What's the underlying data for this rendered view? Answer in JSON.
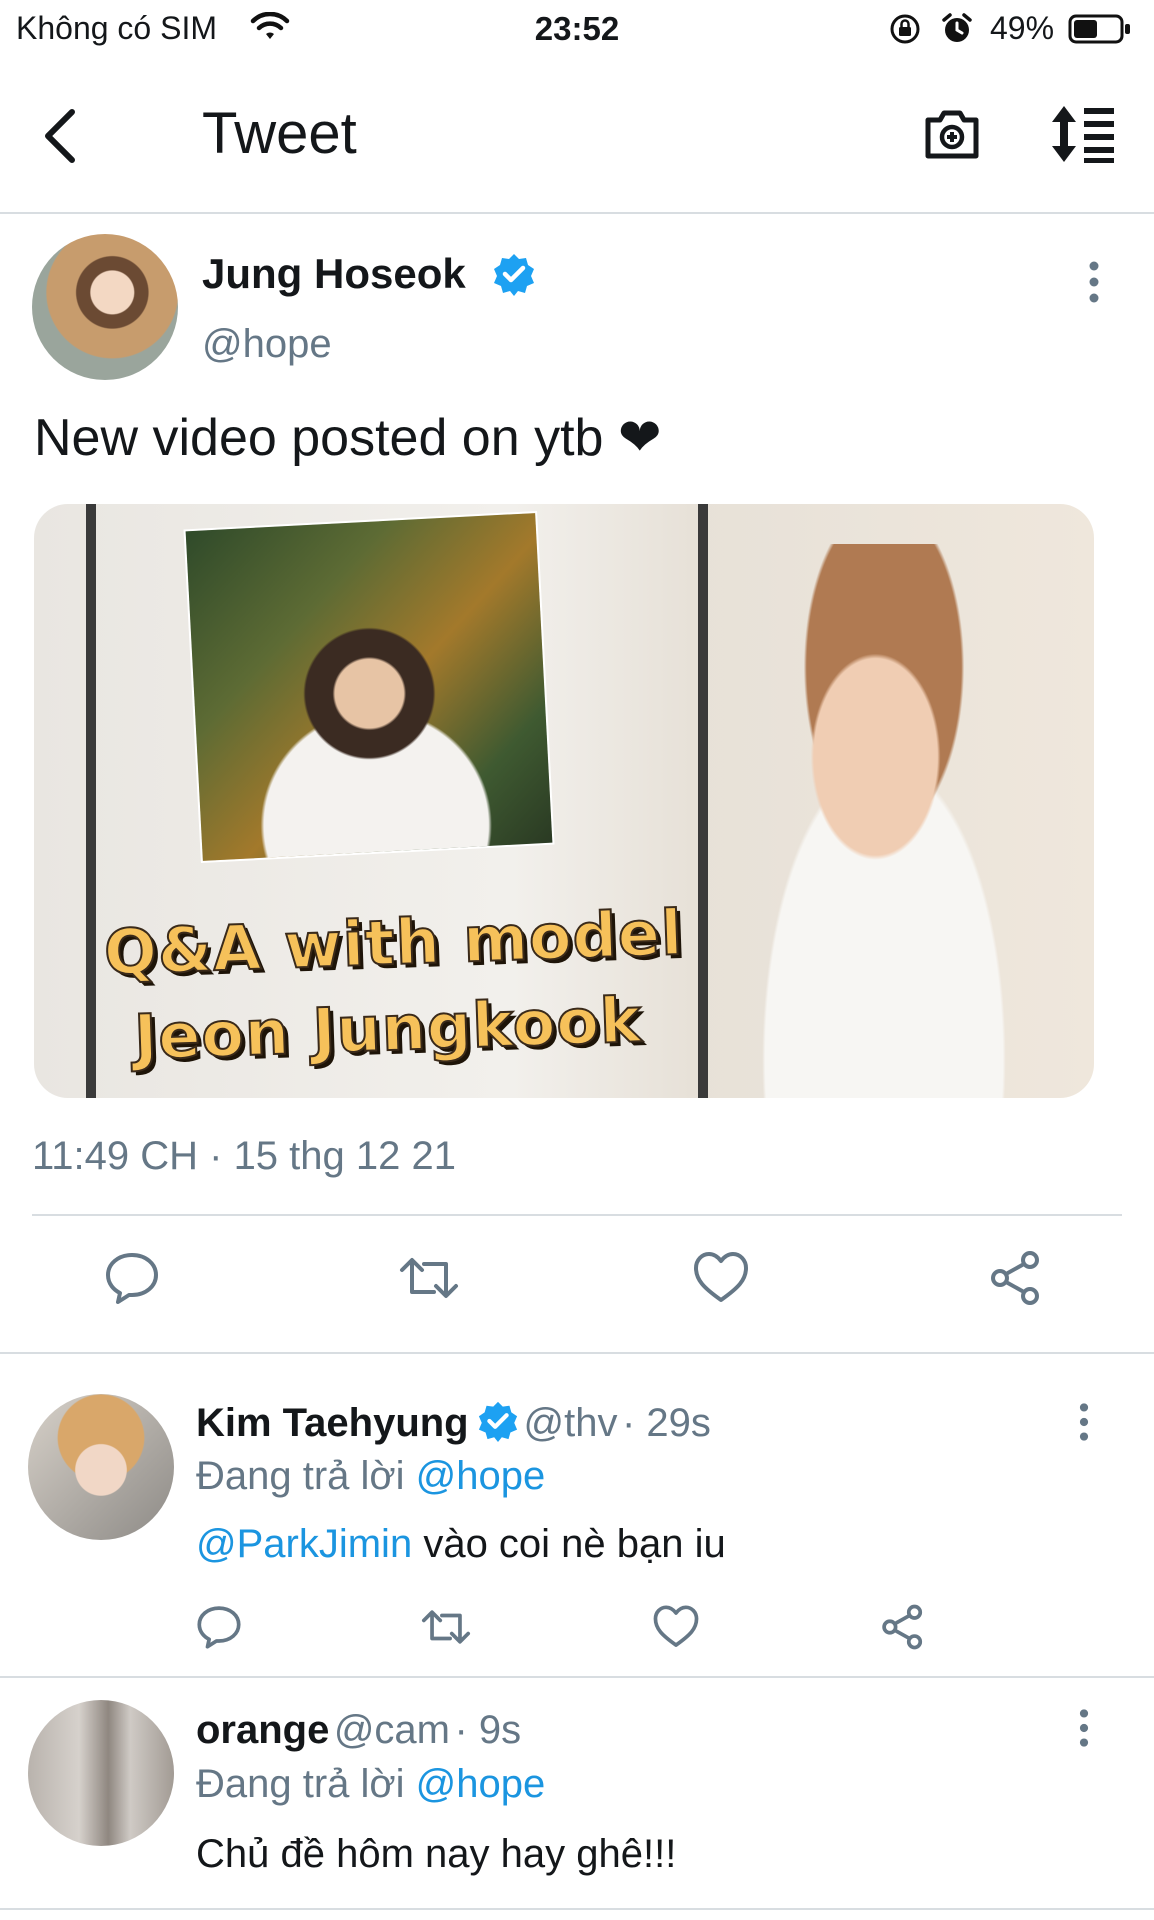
{
  "status_bar": {
    "carrier": "Không có SIM",
    "time": "23:52",
    "battery": "49%"
  },
  "nav": {
    "title": "Tweet"
  },
  "tweet": {
    "author_name": "Jung Hoseok",
    "author_handle": "@hope",
    "text": "New video posted on ytb ❤",
    "media_caption_line1": "Q&A with model",
    "media_caption_line2": "Jeon Jungkook",
    "timestamp": "11:49 CH · 15 thg 12 21"
  },
  "replies": [
    {
      "name": "Kim Taehyung",
      "handle": "@thv",
      "age": "29s",
      "replying_prefix": "Đang trả lời ",
      "replying_to": "@hope",
      "mention": "@ParkJimin",
      "text": " vào coi nè bạn iu"
    },
    {
      "name": "orange",
      "handle": "@cam",
      "age": "9s",
      "replying_prefix": "Đang trả lời ",
      "replying_to": "@hope",
      "text": "Chủ đề hôm nay hay ghê!!!"
    }
  ],
  "colors": {
    "accent": "#1b95e0",
    "verified": "#1da1f2",
    "secondary_text": "#657786",
    "divider": "#d8dde1"
  },
  "icons": {
    "back": "chevron-left-icon",
    "camera": "camera-plus-icon",
    "sort": "sort-icon",
    "reply": "comment-icon",
    "retweet": "retweet-icon",
    "like": "heart-icon",
    "share": "share-icon",
    "more": "more-vertical-icon",
    "verified": "verified-badge-icon"
  }
}
